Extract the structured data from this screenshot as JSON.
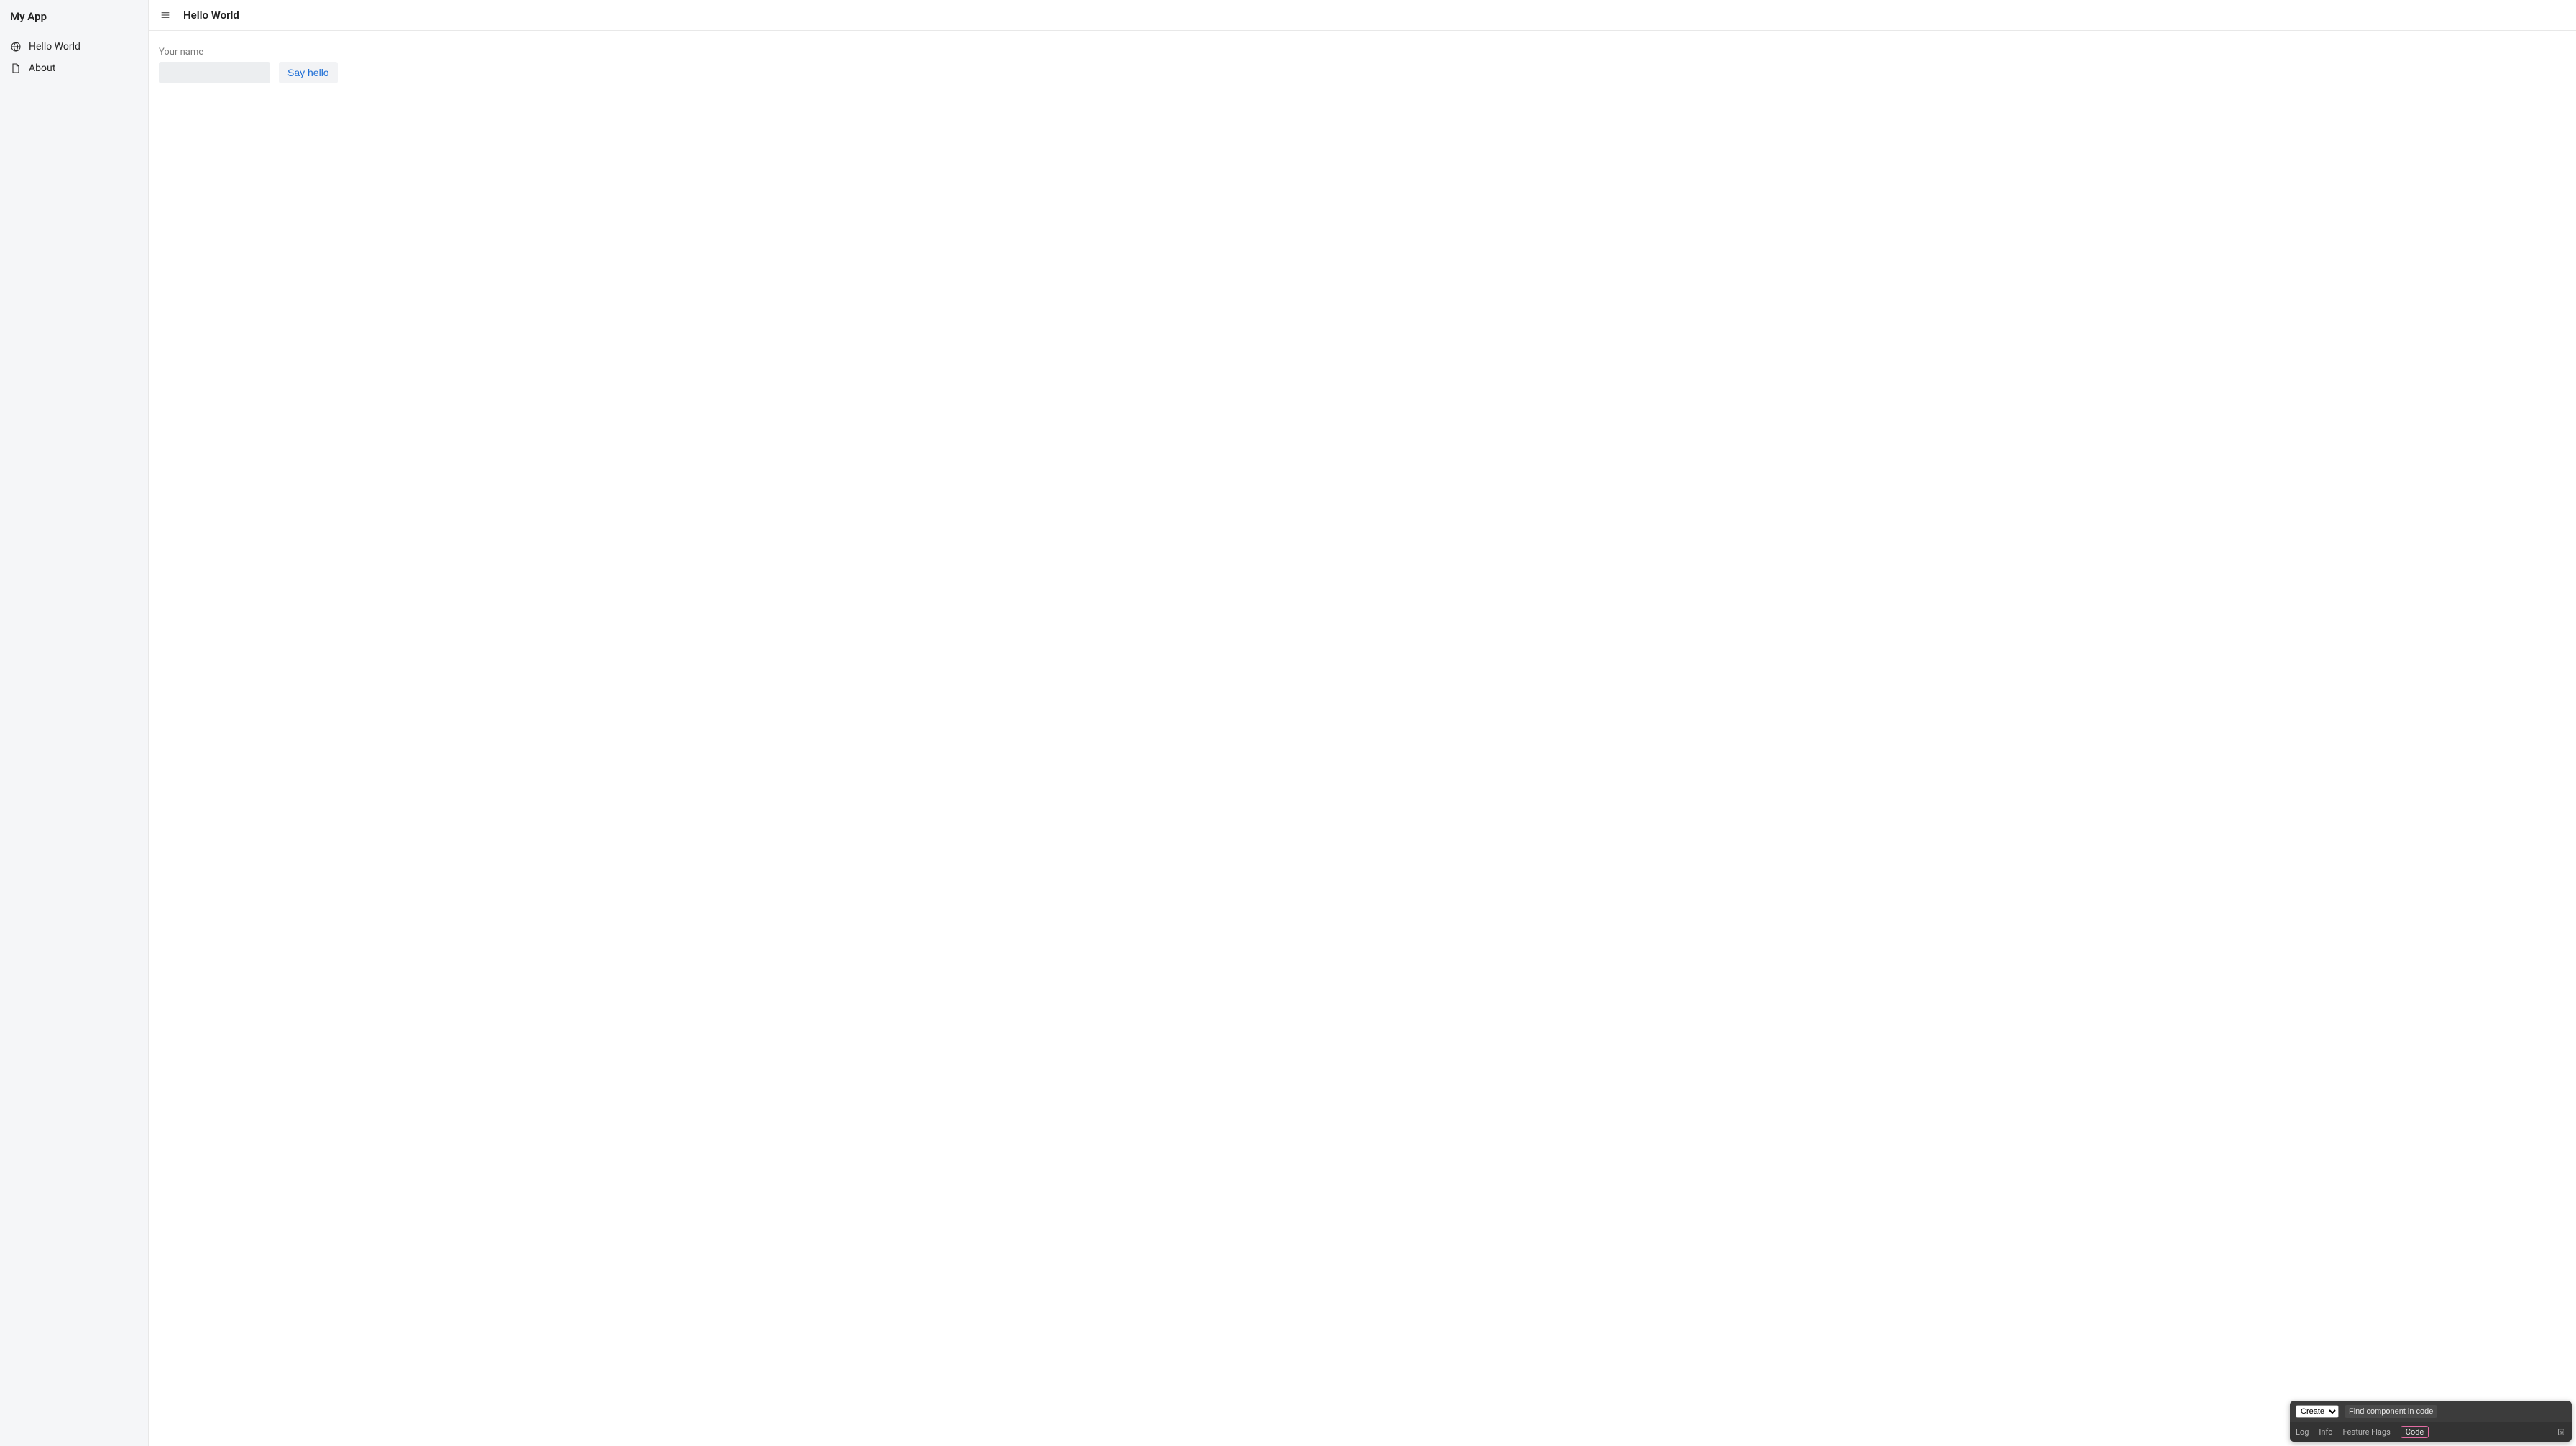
{
  "sidebar": {
    "title": "My App",
    "items": [
      {
        "label": "Hello World",
        "icon": "globe-icon"
      },
      {
        "label": "About",
        "icon": "document-icon"
      }
    ]
  },
  "header": {
    "title": "Hello World"
  },
  "form": {
    "name_label": "Your name",
    "name_value": "",
    "say_hello_label": "Say hello"
  },
  "devtool": {
    "create_label": "Create",
    "find_label": "Find component in code",
    "tabs": {
      "log": "Log",
      "info": "Info",
      "feature_flags": "Feature Flags",
      "code": "Code"
    }
  }
}
